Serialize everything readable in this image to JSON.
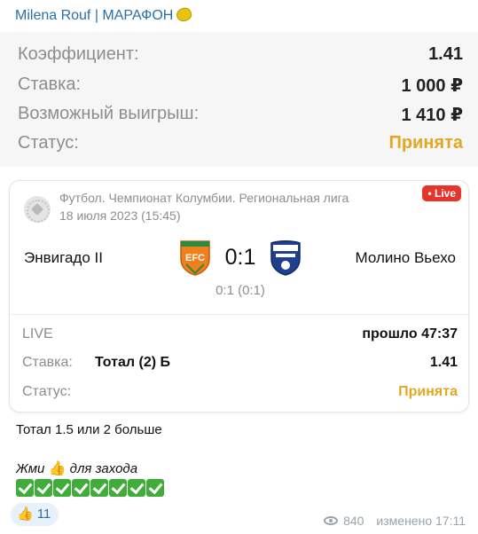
{
  "channel": {
    "name": "Milena Rouf | МАРАФОН",
    "icon": "lemon-icon"
  },
  "bet_summary": {
    "rows": [
      {
        "label": "Коэффициент:",
        "value": "1.41"
      },
      {
        "label": "Ставка:",
        "value": "1 000 ₽"
      },
      {
        "label": "Возможный выигрыш:",
        "value": "1 410 ₽"
      },
      {
        "label": "Статус:",
        "value": "Принята"
      }
    ]
  },
  "event": {
    "league": "Футбол. Чемпионат Колумбии. Региональная лига",
    "date": "18 июля 2023 (15:45)",
    "live_badge": "• Live",
    "home_team": "Энвигадо II",
    "away_team": "Молино Вьехо",
    "score": "0:1",
    "half_score": "0:1 (0:1)",
    "live_label": "LIVE",
    "elapsed": "прошло 47:37",
    "stake_label": "Ставка:",
    "stake_selection": "Тотал (2) Б",
    "stake_coef": "1.41",
    "status_label": "Статус:",
    "status_value": "Принята",
    "home_logo_text": "EFC"
  },
  "message": {
    "caption": "Тотал 1.5 или 2 больше",
    "cta_before": "Жми",
    "cta_after": "для захода",
    "checks_count": 8
  },
  "reaction": {
    "emoji": "👍",
    "count": "11"
  },
  "meta": {
    "views": "840",
    "edited": "изменено 17:11"
  },
  "colors": {
    "accent": "#2a6fa8",
    "accepted": "#e2a823",
    "live": "#e8352b",
    "check": "#40ad3a"
  }
}
